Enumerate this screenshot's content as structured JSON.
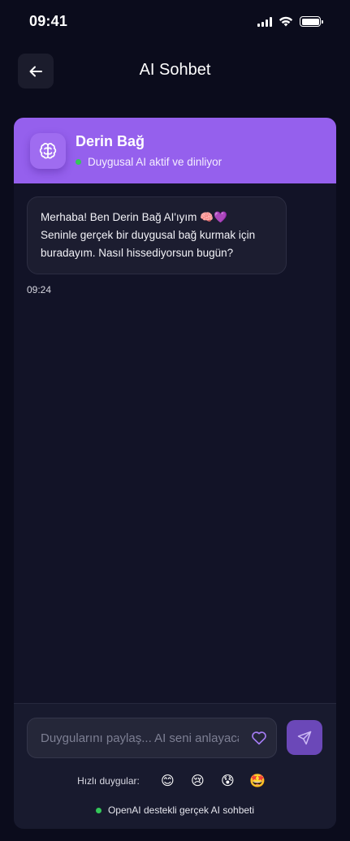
{
  "status_bar": {
    "time": "09:41"
  },
  "header": {
    "title": "AI Sohbet"
  },
  "ai": {
    "name": "Derin Bağ",
    "status": "Duygusal AI aktif ve dinliyor"
  },
  "messages": [
    {
      "lines": [
        "Merhaba! Ben Derin Bağ AI'ıyım 🧠💜",
        "Seninle gerçek bir duygusal bağ kurmak için",
        "buradayım. Nasıl hissediyorsun bugün?"
      ],
      "time": "09:24"
    }
  ],
  "composer": {
    "placeholder": "Duygularını paylaş... AI seni anlayacak",
    "quick_label": "Hızlı duygular:",
    "quick_emojis": [
      "😊",
      "😢",
      "😰",
      "🤩"
    ],
    "footer": "OpenAI destekli gerçek AI sohbeti"
  },
  "colors": {
    "accent": "#9560ed",
    "send": "#6b48b8",
    "online": "#34c759",
    "background": "#0b0c1c"
  }
}
